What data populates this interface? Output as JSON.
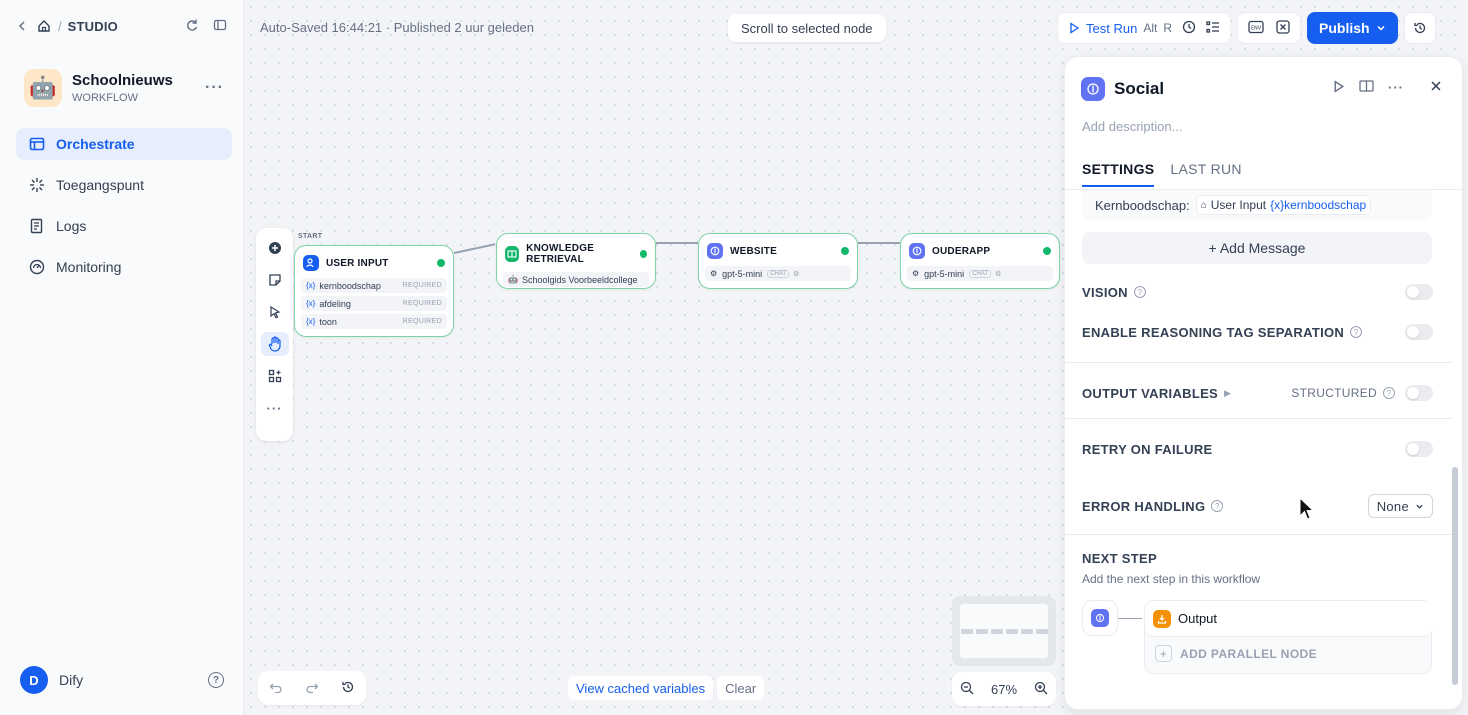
{
  "sidebar": {
    "breadcrumb_studio": "STUDIO",
    "app_name": "Schoolnieuws",
    "app_type": "WORKFLOW",
    "app_more": "···",
    "nav": [
      {
        "label": "Orchestrate",
        "icon": "orchestrate-icon",
        "active": true
      },
      {
        "label": "Toegangspunt",
        "icon": "access-point-icon",
        "active": false
      },
      {
        "label": "Logs",
        "icon": "logs-icon",
        "active": false
      },
      {
        "label": "Monitoring",
        "icon": "monitoring-icon",
        "active": false
      }
    ],
    "user_initial": "D",
    "user_name": "Dify"
  },
  "header": {
    "autosave": "Auto-Saved 16:44:21 · Published 2 uur geleden",
    "scroll_to_node": "Scroll to selected node",
    "test_run": "Test Run",
    "shortcut_alt": "Alt",
    "shortcut_r": "R",
    "publish": "Publish"
  },
  "nodes": {
    "start_label": "START",
    "user_input": {
      "title": "USER INPUT",
      "vars": [
        {
          "name": "kernboodschap",
          "req": "REQUIRED"
        },
        {
          "name": "afdeling",
          "req": "REQUIRED"
        },
        {
          "name": "toon",
          "req": "REQUIRED"
        }
      ]
    },
    "knowledge": {
      "title": "KNOWLEDGE RETRIEVAL",
      "row": "Schoolgids Voorbeeldcollege"
    },
    "website": {
      "title": "WEBSITE",
      "model": "gpt-5-mini",
      "tag": "CHAT"
    },
    "ouderapp": {
      "title": "OUDERAPP",
      "model": "gpt-5-mini",
      "tag": "CHAT"
    }
  },
  "canvas_footer": {
    "view_cached": "View cached variables",
    "clear": "Clear",
    "zoom": "67%"
  },
  "panel": {
    "title": "Social",
    "description_placeholder": "Add description...",
    "tabs": [
      "SETTINGS",
      "LAST RUN"
    ],
    "message_label": "Kernboodschap:",
    "message_chip_node": "User Input",
    "message_chip_var": "kernboodschap",
    "add_message": "+ Add Message",
    "vision": "VISION",
    "reasoning": "ENABLE REASONING TAG SEPARATION",
    "output_variables": "OUTPUT VARIABLES",
    "structured": "STRUCTURED",
    "retry": "RETRY ON FAILURE",
    "error_handling": "ERROR HANDLING",
    "error_value": "None",
    "next_step_title": "NEXT STEP",
    "next_step_sub": "Add the next step in this workflow",
    "next_output": "Output",
    "add_parallel": "ADD PARALLEL NODE"
  },
  "colors": {
    "accent": "#155eef",
    "node_border": "#7fd4a5",
    "success": "#12b76a",
    "llm_badge": "#6172f3",
    "knowledge_badge": "#12b76a",
    "output_badge": "#f79009"
  }
}
